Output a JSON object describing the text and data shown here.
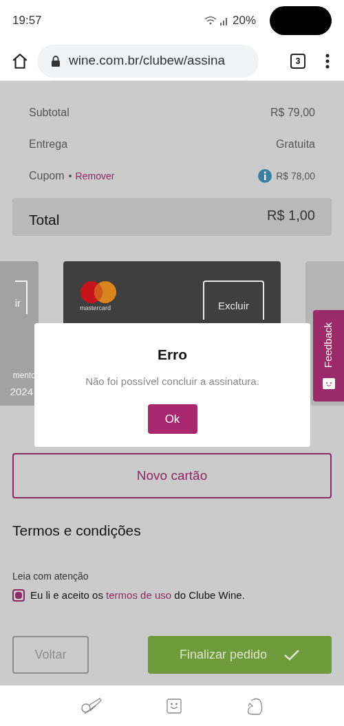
{
  "status_bar": {
    "time": "19:57",
    "battery": "20%"
  },
  "browser": {
    "url": "wine.com.br/clubew/assina",
    "tab_count": "3"
  },
  "summary": [
    {
      "kind": "plain",
      "label": "Subtotal",
      "value": "R$ 79,00"
    },
    {
      "kind": "plain",
      "label": "Entrega",
      "value": "Gratuita"
    },
    {
      "kind": "coupon",
      "label": "Cupom",
      "link": "Remover",
      "value": "R$ 78,00"
    }
  ],
  "total": {
    "label": "Total",
    "value": "R$ 1,00"
  },
  "cards": {
    "previous": {
      "button": "ir",
      "label": "mento",
      "value": "2024"
    },
    "current": {
      "brand": "mastercard",
      "button": "Excluir"
    }
  },
  "dialog": {
    "title": "Erro",
    "message": "Não foi possível concluir a assinatura.",
    "button": "Ok"
  },
  "feedback_tab": "Feedback",
  "new_card_button": "Novo cartão",
  "terms": {
    "heading": "Termos e condições",
    "note": "Leia com atenção",
    "checked": true,
    "before": "Eu li e aceito os",
    "link": "termos de uso",
    "after": "do Clube Wine."
  },
  "buttons": {
    "back": "Voltar",
    "finish": "Finalizar pedido"
  }
}
